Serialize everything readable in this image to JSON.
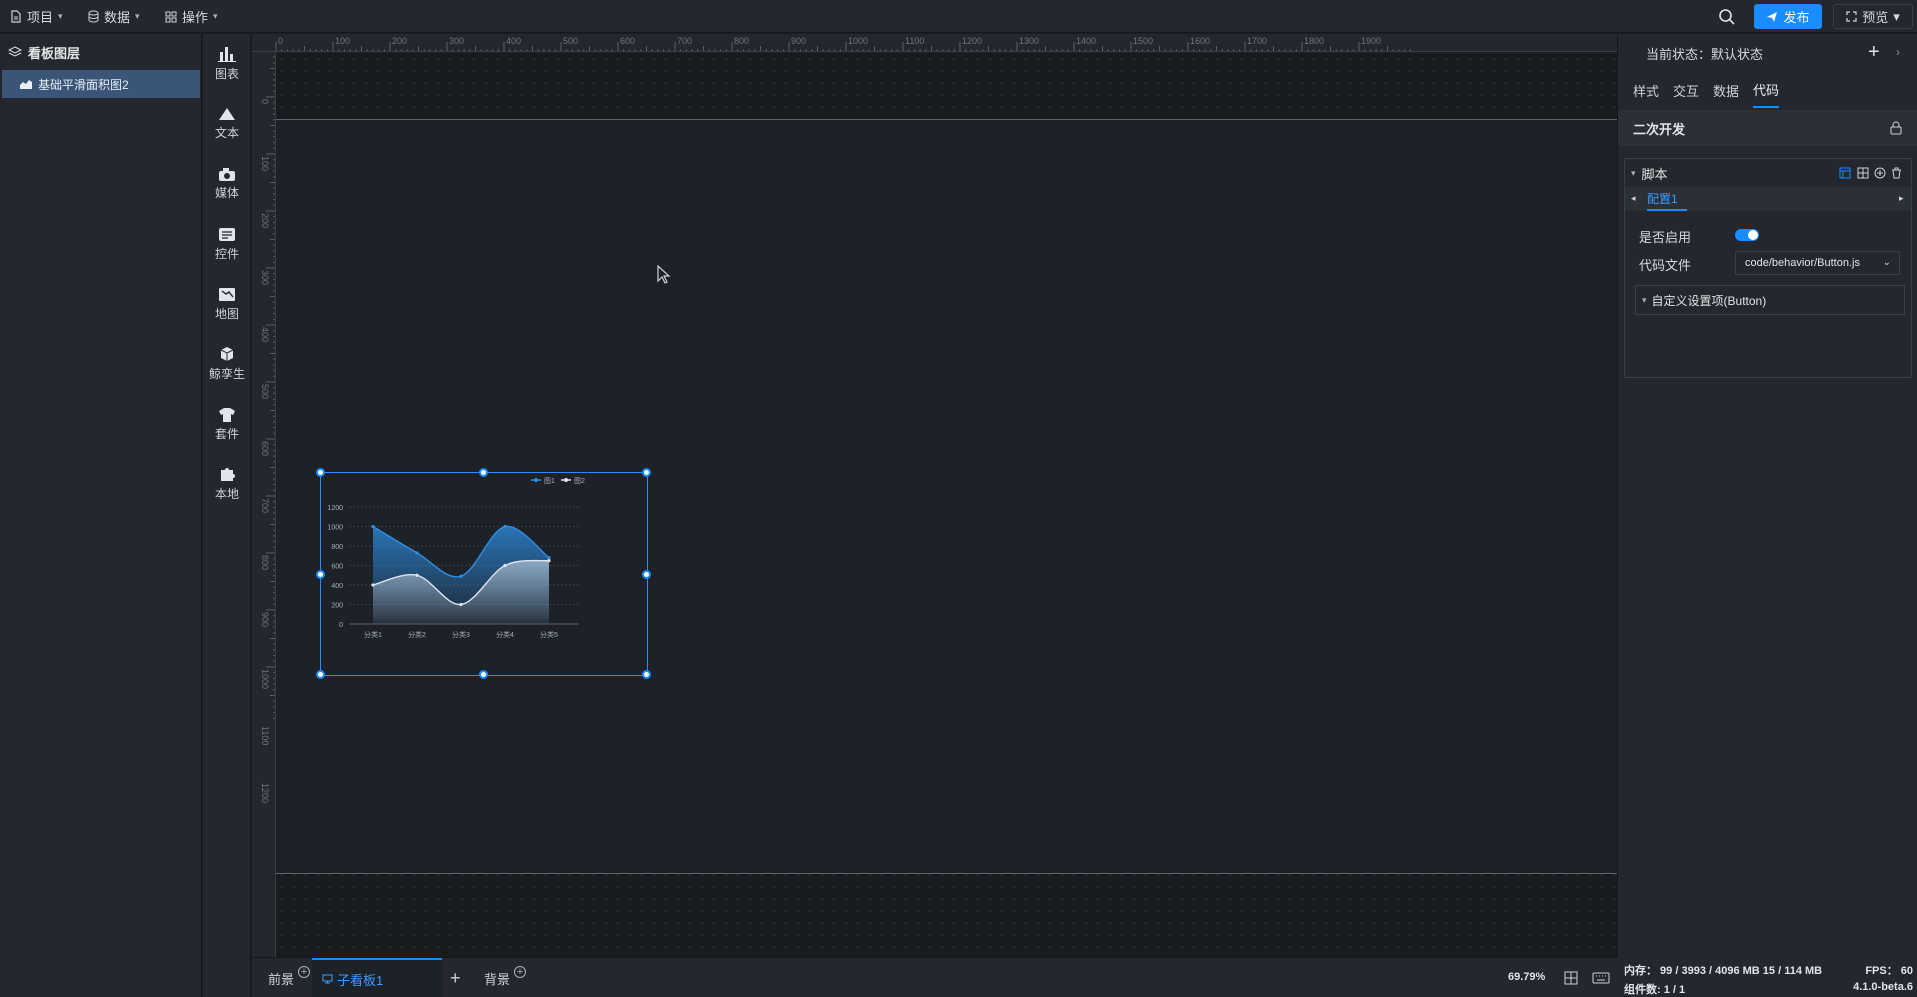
{
  "topbar": {
    "menus": [
      {
        "label": "项目",
        "icon": "file-icon"
      },
      {
        "label": "数据",
        "icon": "database-icon"
      },
      {
        "label": "操作",
        "icon": "grid-icon"
      }
    ],
    "publish_label": "发布",
    "preview_label": "预览"
  },
  "layers": {
    "title": "看板图层",
    "items": [
      {
        "label": "基础平滑面积图2"
      }
    ]
  },
  "components": [
    {
      "label": "图表",
      "icon": "bar-chart-icon"
    },
    {
      "label": "文本",
      "icon": "text-icon"
    },
    {
      "label": "媒体",
      "icon": "camera-icon"
    },
    {
      "label": "控件",
      "icon": "controls-icon"
    },
    {
      "label": "地图",
      "icon": "map-icon"
    },
    {
      "label": "鲸孪生",
      "icon": "cube-icon"
    },
    {
      "label": "套件",
      "icon": "shirt-icon"
    },
    {
      "label": "本地",
      "icon": "puzzle-icon"
    }
  ],
  "ruler": {
    "top_ticks": [
      "0",
      "100",
      "200",
      "300",
      "400",
      "500",
      "600",
      "700",
      "800",
      "900",
      "1000",
      "1100",
      "1200",
      "1300",
      "1400",
      "1500",
      "1600",
      "1700",
      "1800",
      "1900"
    ],
    "left_ticks": [
      "0",
      "100",
      "200",
      "300",
      "400",
      "500",
      "600",
      "700",
      "800",
      "900",
      "1000",
      "1100",
      "1200"
    ]
  },
  "chart_data": {
    "type": "area",
    "categories": [
      "分类1",
      "分类2",
      "分类3",
      "分类4",
      "分类5"
    ],
    "series": [
      {
        "name": "图1",
        "values": [
          1000,
          730,
          490,
          1000,
          680
        ],
        "color": "#2d8fe6"
      },
      {
        "name": "图2",
        "values": [
          400,
          500,
          200,
          600,
          650
        ],
        "color": "#dfe6ef"
      }
    ],
    "yticks": [
      "0",
      "200",
      "400",
      "600",
      "800",
      "1000",
      "1200"
    ],
    "ylim": [
      0,
      1200
    ],
    "legend": "top-right",
    "grid": true
  },
  "bottombar": {
    "tabs": [
      {
        "label": "前景"
      },
      {
        "label": "子看板1"
      },
      {
        "label": "背景"
      }
    ],
    "add_label": "+",
    "zoom": "69.79%"
  },
  "panel": {
    "state_label": "当前状态：默认状态",
    "tabs": [
      "样式",
      "交互",
      "数据",
      "代码"
    ],
    "active_tab": "代码",
    "section_title": "二次开发",
    "script_title": "脚本",
    "config_tab": "配置1",
    "enable_label": "是否启用",
    "enabled": true,
    "code_file_label": "代码文件",
    "code_file_value": "code/behavior/Button.js",
    "custom_section": "自定义设置项(Button)"
  },
  "status": {
    "memory": "内存： 99 / 3993 / 4096 MB  15 / 114 MB",
    "fps": "FPS： 60",
    "component_count": "组件数: 1 / 1",
    "version": "4.1.0-beta.6"
  },
  "colors": {
    "accent": "#1a8cff",
    "panel": "#24272d",
    "canvas": "#1d2229"
  }
}
